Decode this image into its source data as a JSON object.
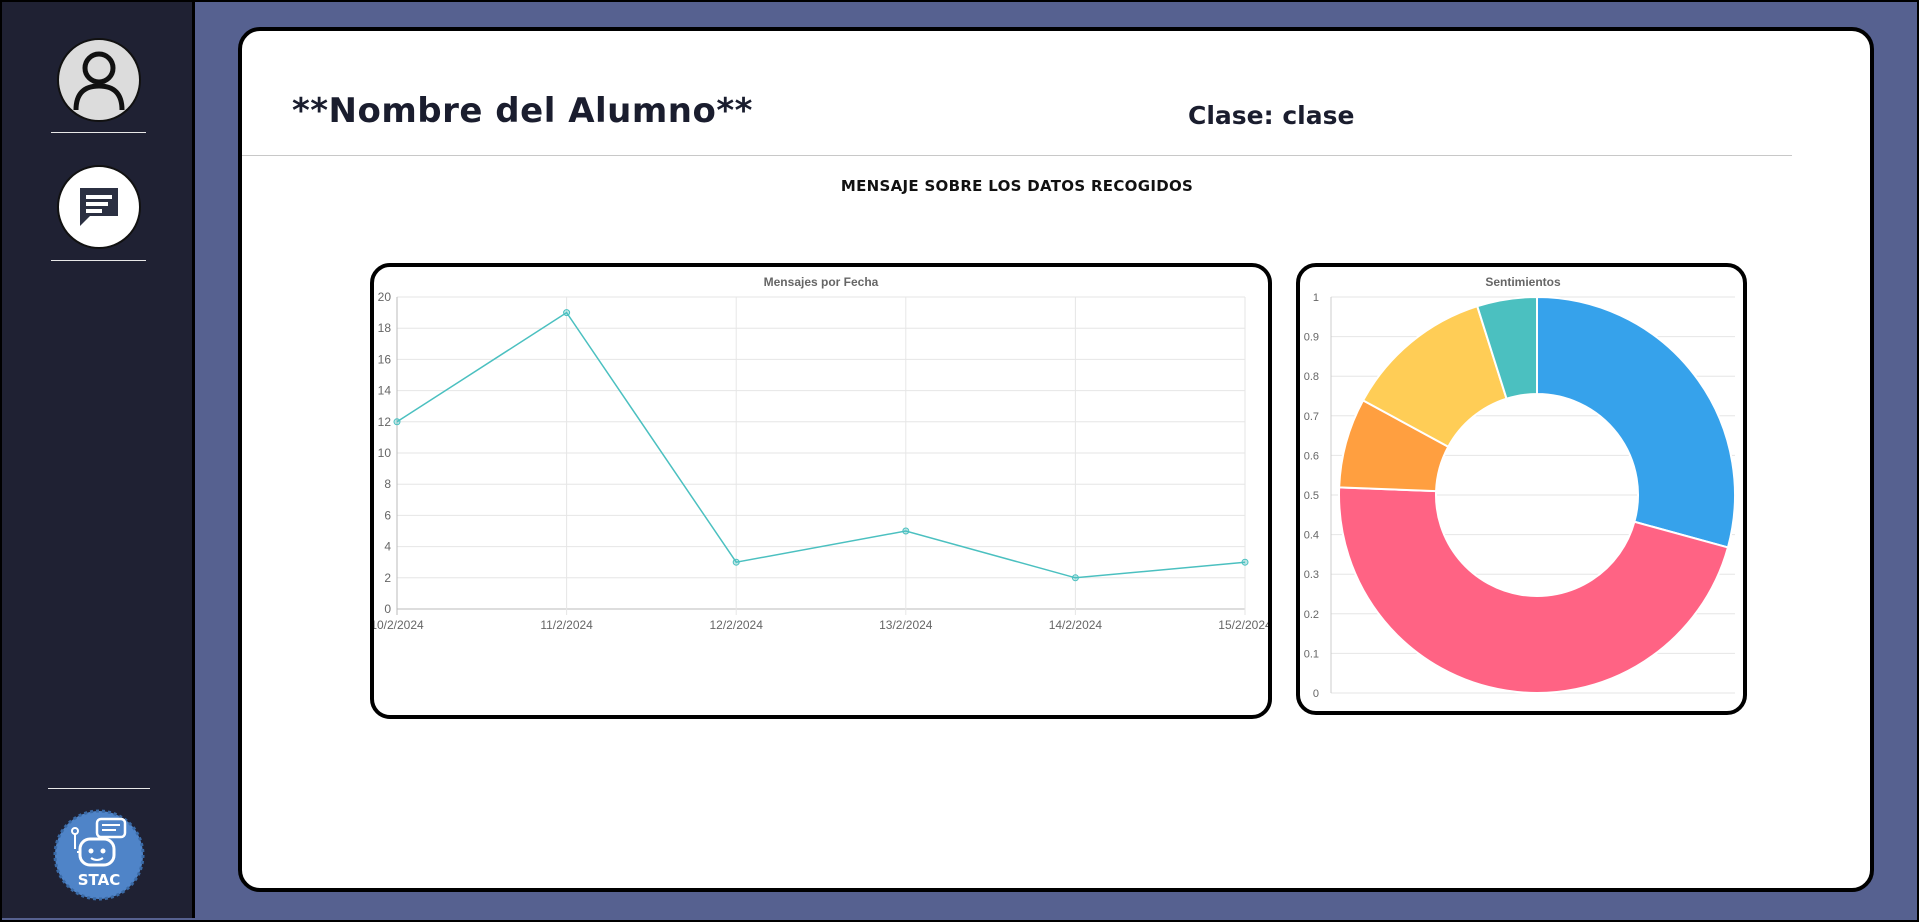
{
  "sidebar": {
    "icons": [
      "user-icon",
      "chat-icon"
    ],
    "logo_text": "STAC"
  },
  "header": {
    "student_name": "**Nombre del Alumno**",
    "class_label": "Clase: clase"
  },
  "message": "MENSAJE SOBRE LOS DATOS RECOGIDOS",
  "colors": {
    "sidebar_bg": "#1f2133",
    "page_bg": "#566190",
    "line": "#4bc0c0",
    "slices": [
      "#36a2eb",
      "#ff6384",
      "#ff9f40",
      "#ffcd56",
      "#4bc0c0"
    ]
  },
  "chart_data": [
    {
      "type": "line",
      "title": "Mensajes por Fecha",
      "x": [
        "10/2/2024",
        "11/2/2024",
        "12/2/2024",
        "13/2/2024",
        "14/2/2024",
        "15/2/2024"
      ],
      "series": [
        {
          "values": [
            12,
            19,
            3,
            5,
            2,
            3
          ]
        }
      ],
      "ylim": [
        0,
        20
      ],
      "yticks": [
        "0",
        "2",
        "4",
        "6",
        "8",
        "10",
        "12",
        "14",
        "16",
        "18",
        "20"
      ],
      "grid": true
    },
    {
      "type": "pie",
      "title": "Sentimientos",
      "values": [
        12,
        19,
        3,
        5,
        2
      ],
      "ylim": [
        0,
        1
      ],
      "yticks": [
        "0",
        "0.1",
        "0.2",
        "0.3",
        "0.4",
        "0.5",
        "0.6",
        "0.7",
        "0.8",
        "0.9",
        "1"
      ],
      "grid": true
    }
  ]
}
